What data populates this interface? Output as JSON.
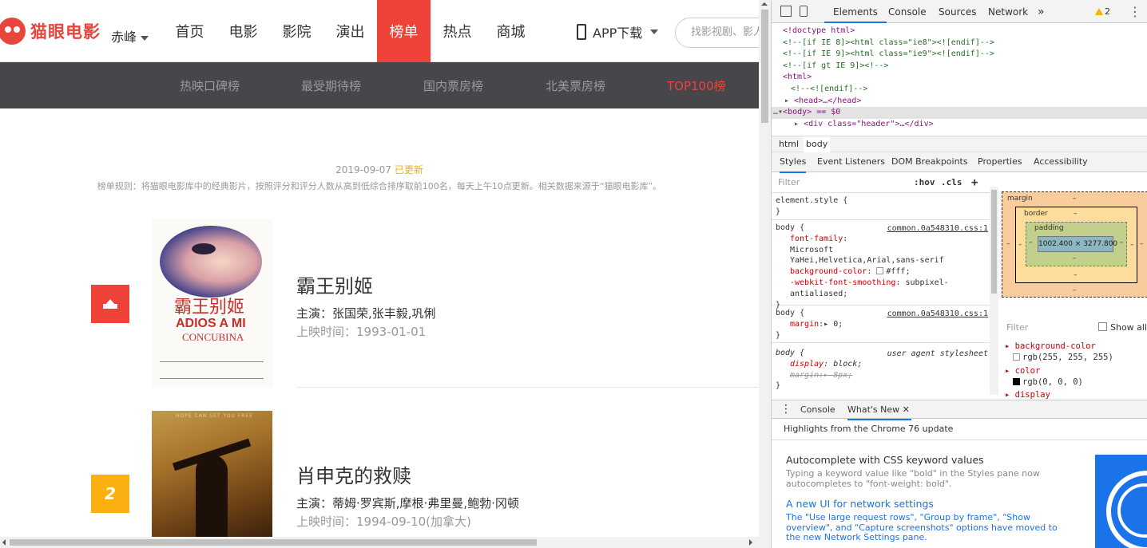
{
  "site": {
    "logo_text": "猫眼电影",
    "city": "赤峰",
    "nav": [
      "首页",
      "电影",
      "影院",
      "演出",
      "榜单",
      "热点",
      "商城"
    ],
    "nav_active": "榜单",
    "app_download": "APP下载",
    "search_placeholder": "找影视剧、影人、影院",
    "subnav": [
      "热映口碑榜",
      "最受期待榜",
      "国内票房榜",
      "北美票房榜",
      "TOP100榜"
    ],
    "subnav_active": "TOP100榜",
    "update_date": "2019-09-07",
    "update_status": "已更新",
    "rule_text": "榜单规则：将猫眼电影库中的经典影片，按照评分和评分人数从高到低综合排序取前100名，每天上午10点更新。相关数据来源于“猫眼电影库”。",
    "movies": [
      {
        "rank": "1",
        "title": "霸王别姬",
        "cast": "主演：张国荣,张丰毅,巩俐",
        "release": "上映时间：1993-01-01",
        "poster_cn": "霸王别姬",
        "poster_en1": "ADIOS A MI",
        "poster_en2": "CONCUBINA"
      },
      {
        "rank": "2",
        "title": "肖申克的救赎",
        "cast": "主演：蒂姆·罗宾斯,摩根·弗里曼,鲍勃·冈顿",
        "release": "上映时间：1994-09-10(加拿大)",
        "poster_tagline": "HOPE CAN SET YOU FREE"
      }
    ]
  },
  "devtools": {
    "tabs": [
      "Elements",
      "Console",
      "Sources",
      "Network"
    ],
    "active_tab": "Elements",
    "more_tabs": "»",
    "warning_count": "2",
    "menu": "⋮",
    "code_lines": [
      "<!doctype html>",
      "<!--[if IE 8]><html class=\"ie8\"><![endif]-->",
      "<!--[if IE 9]><html class=\"ie9\"><![endif]-->",
      "<!--[if gt IE 9]><!-->",
      "<html>",
      "<!--<![endif]-->",
      "<head>…</head>",
      "<body> == $0",
      "<div class=\"header\">…</div>"
    ],
    "breadcrumbs": [
      "html",
      "body"
    ],
    "styles_tabs": [
      "Styles",
      "Event Listeners",
      "DOM Breakpoints",
      "Properties",
      "Accessibility"
    ],
    "styles_filter": "Filter",
    "hov": ":hov",
    "cls": ".cls",
    "plus": "+",
    "rules": {
      "element_style": "element.style {",
      "body_source": "common.0a548310.css:1",
      "font_family_prop": "font-family",
      "font_family_val": "Microsoft YaHei,Helvetica,Arial,sans-serif",
      "bg_prop": "background-color",
      "bg_val": "#fff",
      "smoothing_prop": "-webkit-font-smoothing",
      "smoothing_val": "subpixel-antialiased",
      "margin_prop": "margin",
      "margin_val": "0",
      "ua_label": "user agent stylesheet",
      "display_prop": "display",
      "display_val": "block",
      "ua_margin_prop": "margin",
      "ua_margin_val": "8px"
    },
    "box_model": {
      "margin_label": "margin",
      "border_label": "border",
      "padding_label": "padding",
      "content_size": "1002.400 × 3277.800",
      "dash": "–"
    },
    "computed": {
      "filter": "Filter",
      "show_all": "Show all",
      "props": [
        {
          "name": "background-color",
          "value": "rgb(255, 255, 255)",
          "swatch": "#ffffff"
        },
        {
          "name": "color",
          "value": "rgb(0, 0, 0)",
          "swatch": "#000000"
        },
        {
          "name": "display",
          "value": ""
        }
      ]
    },
    "drawer_tabs": [
      "Console",
      "What's New"
    ],
    "drawer_active": "What's New",
    "highlights": "Highlights from the Chrome 76 update",
    "whatsnew": [
      {
        "heading": "Autocomplete with CSS keyword values",
        "body": "Typing a keyword value like \"bold\" in the Styles pane now autocompletes to \"font-weight: bold\"."
      },
      {
        "heading": "A new UI for network settings",
        "body": "The \"Use large request rows\", \"Group by frame\", \"Show overview\", and \"Capture screenshots\" options have moved to the new Network Settings pane."
      }
    ]
  }
}
